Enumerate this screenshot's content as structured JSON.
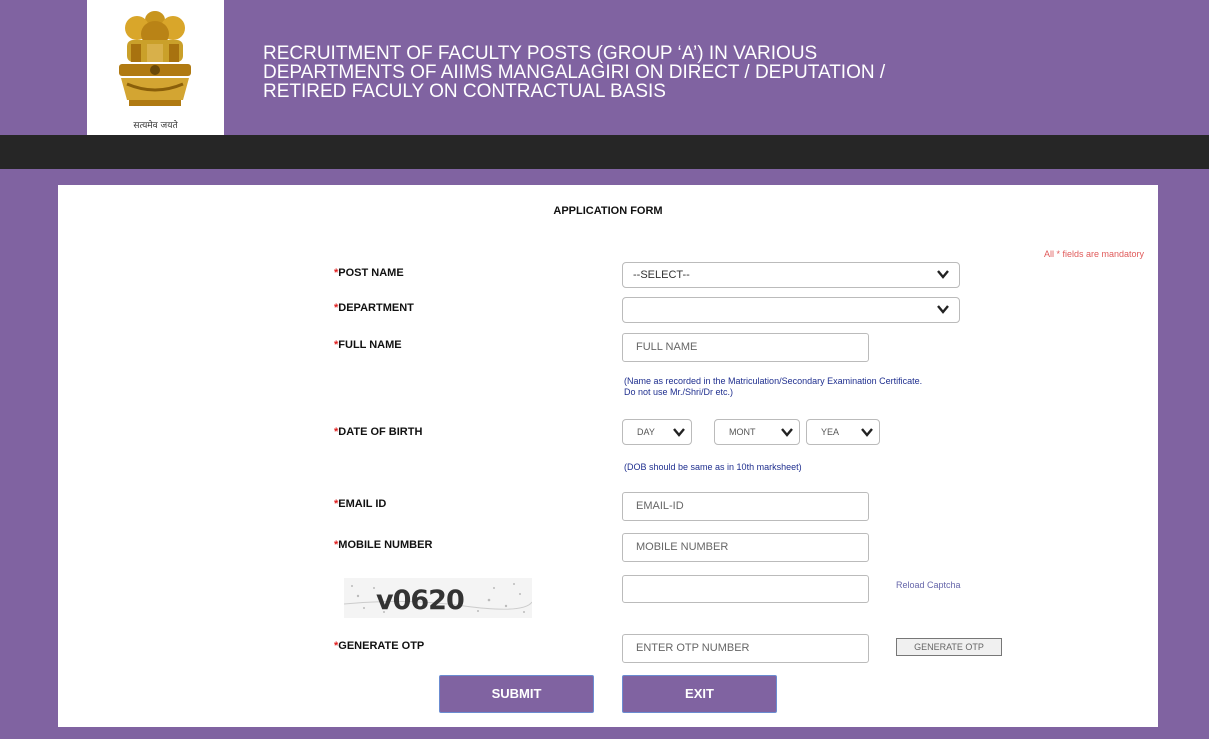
{
  "header": {
    "title_line1": "RECRUITMENT OF FACULTY POSTS (GROUP ‘A’) IN VARIOUS",
    "title_line2": "DEPARTMENTS OF AIIMS MANGALAGIRI ON DIRECT / DEPUTATION /",
    "title_line3": "RETIRED FACULY ON CONTRACTUAL BASIS",
    "emblem_caption": "सत्यमेव जयते"
  },
  "form": {
    "title": "APPLICATION FORM",
    "mandatory_note": "All * fields are mandatory",
    "required_marker": "*",
    "post_name": {
      "label": "POST NAME",
      "value": "--SELECT--"
    },
    "department": {
      "label": "DEPARTMENT",
      "value": ""
    },
    "full_name": {
      "label": "FULL NAME",
      "placeholder": "FULL NAME",
      "hint_line1": "(Name as recorded in the Matriculation/Secondary Examination Certificate.",
      "hint_line2": "Do not use Mr./Shri/Dr etc.)"
    },
    "dob": {
      "label": "DATE OF BIRTH",
      "day": "DAY",
      "month": "MONT",
      "year": "YEA",
      "hint": "(DOB should be same as in 10th marksheet)"
    },
    "email": {
      "label": "EMAIL ID",
      "placeholder": "EMAIL-ID"
    },
    "mobile": {
      "label": "MOBILE NUMBER",
      "placeholder": "MOBILE NUMBER"
    },
    "captcha": {
      "text": "v0620",
      "input_value": "",
      "reload_label": "Reload Captcha"
    },
    "otp": {
      "label": "GENERATE OTP",
      "placeholder": "ENTER OTP NUMBER",
      "button_label": "GENERATE OTP"
    },
    "submit_label": "SUBMIT",
    "exit_label": "EXIT"
  },
  "colors": {
    "brand_purple": "#8063a1",
    "nav_dark": "#262626",
    "required_red": "#e02020",
    "hint_blue": "#1f2f8f"
  },
  "icons": [
    "national-emblem-icon",
    "chevron-down-icon"
  ]
}
